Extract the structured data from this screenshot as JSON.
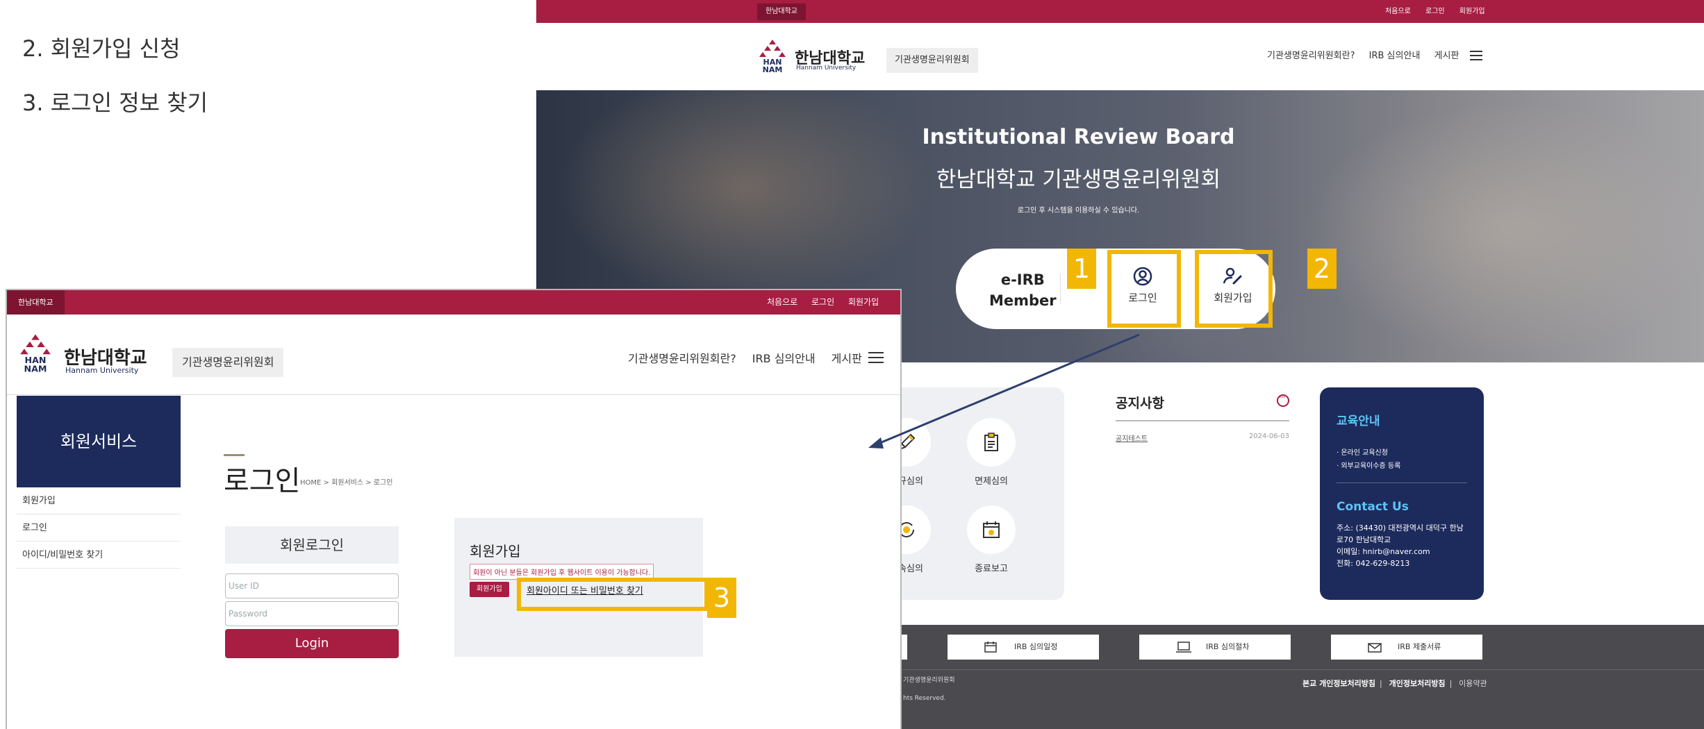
{
  "steps": [
    "2.  회원가입 신청",
    "3.  로그인 정보 찾기"
  ],
  "colors": {
    "brand": "#a81d42",
    "navy": "#1d2b5c",
    "highlight": "#f2b705"
  },
  "main": {
    "topbar": {
      "tag": "한남대학교",
      "links": [
        "처음으로",
        "로그인",
        "회원가입"
      ]
    },
    "logo": {
      "mark": "HAN NAM",
      "name": "한남대학교",
      "sub": "Hannam University"
    },
    "committee": "기관생명윤리위원회",
    "nav": [
      "기관생명윤리위원회란?",
      "IRB 심의안내",
      "게시판"
    ],
    "hero": {
      "title_en": "Institutional Review Board",
      "title_ko": "한남대학교 기관생명윤리위원회",
      "desc": "로그인 후 시스템을 이용하실 수 있습니다.",
      "member_l1": "e-IRB",
      "member_l2": "Member",
      "login_label": "로그인",
      "join_label": "회원가입"
    },
    "highlights": [
      "1",
      "2",
      "3"
    ],
    "quick": [
      "신규심의",
      "면제심의",
      "지속심의",
      "종료보고"
    ],
    "notice": {
      "title": "공지사항",
      "row_title": "공지테스트",
      "row_date": "2024-06-03"
    },
    "edu": {
      "title": "교육안내",
      "items": [
        "· 온라인 교육신청",
        "· 외부교육이수증 등록"
      ],
      "contact_title": "Contact Us",
      "address": "주소: (34430) 대전광역시 대덕구 한남로70 한남대학교",
      "email": "이메일: hnirb@naver.com",
      "phone": "전화: 042-629-8213"
    },
    "footer": {
      "buttons": [
        "IRB 심의일정",
        "IRB 심의절차",
        "IRB 제출서류"
      ],
      "copy1": "기관생명윤리위원회",
      "copy2": "hts Reserved.",
      "policy": [
        "본교 개인정보처리방침",
        "개인정보처리방침",
        "이용약관"
      ]
    }
  },
  "login_page": {
    "topbar": {
      "tag": "한남대학교",
      "links": [
        "처음으로",
        "로그인",
        "회원가입"
      ]
    },
    "nav": [
      "기관생명윤리위원회란?",
      "IRB 심의안내",
      "게시판"
    ],
    "sidebar": {
      "title": "회원서비스",
      "items": [
        "회원가입",
        "로그인",
        "아이디/비밀번호 찾기"
      ]
    },
    "page_title": "로그인",
    "breadcrumb": "HOME > 회원서비스 > 로그인",
    "login_box": {
      "title": "회원로그인",
      "user_placeholder": "User ID",
      "pw_placeholder": "Password",
      "button": "Login"
    },
    "join_box": {
      "title": "회원가입",
      "message": "회원이 아닌 분들은 회원가입 후 웹사이트 이용이 가능합니다.",
      "join_button": "회원가입",
      "find_link": "회원아이디 또는 비밀번호 찾기"
    }
  }
}
